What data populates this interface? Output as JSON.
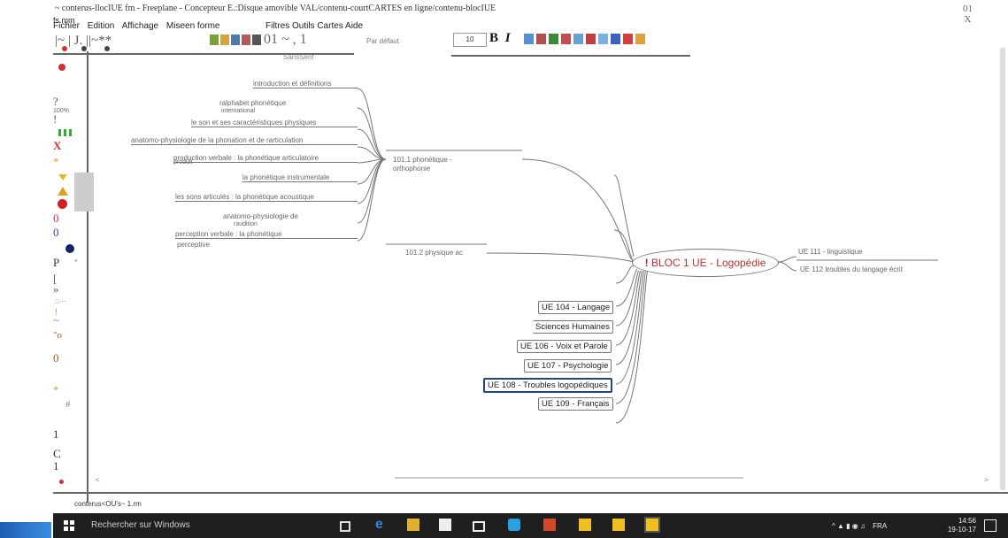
{
  "window": {
    "title": "~ conterus-llocIUE fm - Freeplane - Concepteur E.:Disque amovible VAL/contenu-courtCARTES en ligne/contenu-blocIUE",
    "controls_top": "01",
    "controls_bottom": "X"
  },
  "menubar": {
    "file_overlay": "fs.mm",
    "items": [
      "Fichier",
      "Edition",
      "Affichage",
      "Miseen forme"
    ],
    "items_right": "Filtres Outils Cartes Aide"
  },
  "toolbar": {
    "left_symbols": "|~ | J. ||~**",
    "zoom_text": "01 ~ , 1",
    "style_value": "Par défaut",
    "font_size": "10",
    "bold": "B",
    "italic": "I",
    "font_name": "SansSerif"
  },
  "left_panel": {
    "zoom_label": "100%",
    "symbols": [
      "?",
      "!",
      "X",
      "*",
      "0",
      "0",
      "P",
      "\"",
      "[",
      "»",
      "~",
      "\"o",
      "0",
      "*",
      "#",
      "1",
      "C",
      "1"
    ]
  },
  "mindmap": {
    "central": {
      "icon": "!",
      "label": "BLOC 1 UE - Logopédie"
    },
    "left_branches": [
      "introduction et définitions",
      "ralphabet phonétique",
      "international",
      "le son et ses caractéristiques physiques",
      "anatomo-physiologie de la phonation et de rarticulation",
      "production verbale : la phonétique articulatoire",
      "produit",
      "la phonétique instrumentale",
      "les sons articulés : la phonétique acoustique",
      "anatomo-physiologie de",
      "raudition",
      "perception verbale : la phonétique",
      "perceptive"
    ],
    "mid_nodes": [
      "101.1 phonétique - orthophonie",
      "101.2 physique ac"
    ],
    "ue_nodes": [
      "UE 104 - Langage",
      "Sciences Humaines",
      "UE 106 - Voix et Parole",
      "UE 107 - Psychologie",
      "UE 108 - Troubles logopédiques",
      "UE 109 - Français"
    ],
    "right_nodes": [
      "UE 111 - linguistique",
      "UE 112 troubles du langage écrit"
    ]
  },
  "statusbar": {
    "file": "conterus<OU's~ 1.rm"
  },
  "taskbar": {
    "search_placeholder": "Rechercher sur Windows",
    "lang": "FRA",
    "time": "14:56",
    "date": "19-10-17"
  }
}
